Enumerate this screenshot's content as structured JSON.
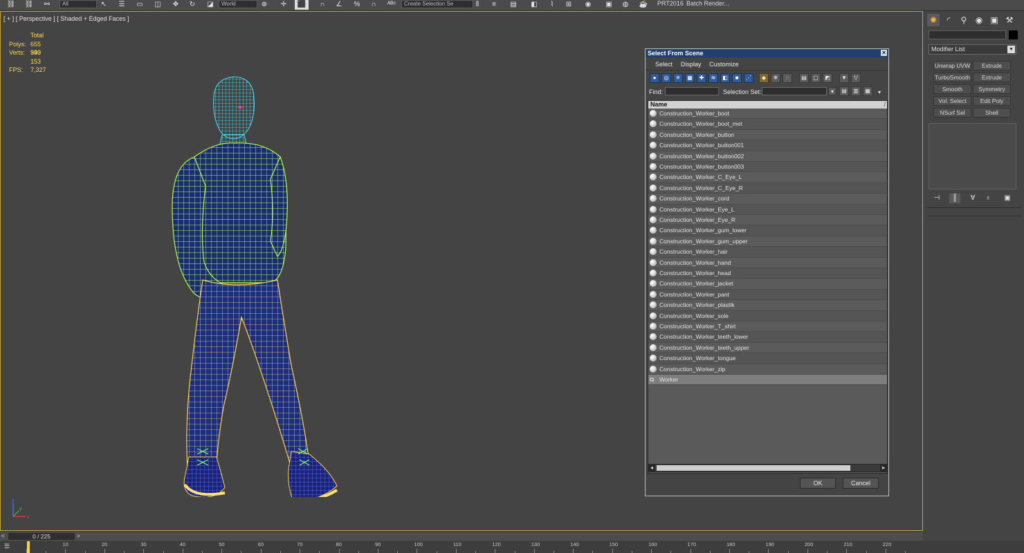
{
  "toolbar": {
    "selection_filter": "All",
    "reference_coord": "World",
    "named_selection_placeholder": "Create Selection Se",
    "prt_label": "PRT2016",
    "batch_render_label": "Batch Render..."
  },
  "viewport": {
    "label": "[ + ] [ Perspective ] [ Shaded + Edged Faces ]",
    "stats": {
      "total_label": "Total",
      "polys_label": "Polys:",
      "polys_value": "655 993",
      "verts_label": "Verts:",
      "verts_value": "340 153",
      "fps_label": "FPS:",
      "fps_value": "7,327"
    },
    "gizmo": {
      "x": "x",
      "y": "y",
      "z": "z"
    }
  },
  "dialog": {
    "title": "Select From Scene",
    "close_glyph": "×",
    "menu": [
      "Select",
      "Display",
      "Customize"
    ],
    "find_label": "Find:",
    "selection_set_label": "Selection Set:",
    "column_name": "Name",
    "items": [
      {
        "name": "Construction_Worker_boot",
        "type": "object"
      },
      {
        "name": "Construction_Worker_boot_met",
        "type": "object"
      },
      {
        "name": "Construction_Worker_button",
        "type": "object"
      },
      {
        "name": "Construction_Worker_button001",
        "type": "object"
      },
      {
        "name": "Construction_Worker_button002",
        "type": "object"
      },
      {
        "name": "Construction_Worker_button003",
        "type": "object"
      },
      {
        "name": "Construction_Worker_C_Eye_L",
        "type": "object"
      },
      {
        "name": "Construction_Worker_C_Eye_R",
        "type": "object"
      },
      {
        "name": "Construction_Worker_cord",
        "type": "object"
      },
      {
        "name": "Construction_Worker_Eye_L",
        "type": "object"
      },
      {
        "name": "Construction_Worker_Eye_R",
        "type": "object"
      },
      {
        "name": "Construction_Worker_gum_lower",
        "type": "object"
      },
      {
        "name": "Construction_Worker_gum_upper",
        "type": "object"
      },
      {
        "name": "Construction_Worker_hair",
        "type": "object"
      },
      {
        "name": "Construction_Worker_hand",
        "type": "object"
      },
      {
        "name": "Construction_Worker_head",
        "type": "object"
      },
      {
        "name": "Construction_Worker_jacket",
        "type": "object"
      },
      {
        "name": "Construction_Worker_pant",
        "type": "object"
      },
      {
        "name": "Construction_Worker_plastik",
        "type": "object"
      },
      {
        "name": "Construction_Worker_sole",
        "type": "object"
      },
      {
        "name": "Construction_Worker_T_shirt",
        "type": "object"
      },
      {
        "name": "Construction_Worker_teeth_lower",
        "type": "object"
      },
      {
        "name": "Construction_Worker_teeth_upper",
        "type": "object"
      },
      {
        "name": "Construction_Worker_tongue",
        "type": "object"
      },
      {
        "name": "Construction_Worker_zip",
        "type": "object"
      },
      {
        "name": "Worker",
        "type": "group",
        "selected": true
      }
    ],
    "ok_label": "OK",
    "cancel_label": "Cancel"
  },
  "command_panel": {
    "modifier_list_label": "Modifier List",
    "buttons": [
      [
        "Unwrap UVW",
        "Extrude"
      ],
      [
        "TurboSmooth",
        "Extrude"
      ],
      [
        "Smooth",
        "Symmetry"
      ],
      [
        "Vol. Select",
        "Edit Poly"
      ],
      [
        "NSurf Sel",
        "Shell"
      ]
    ]
  },
  "time_slider": {
    "frame_display": "0 / 225",
    "prev_glyph": "<",
    "next_glyph": ">"
  },
  "track_bar": {
    "labels": [
      "0",
      "10",
      "20",
      "30",
      "40",
      "50",
      "60",
      "70",
      "80",
      "90",
      "100",
      "110",
      "120",
      "130",
      "140",
      "150",
      "160",
      "170",
      "180",
      "190",
      "200",
      "210",
      "220"
    ]
  },
  "colors": {
    "viewport_border": "#c4a640",
    "stats_text": "#ffd94a",
    "dialog_title_bg": "#1f3f70",
    "wire_head": "#3fe3ff",
    "wire_jacket": "#b6ff3a",
    "wire_pants": "#ffd34a",
    "fill_pants": "#1d2f7a",
    "time_marker": "#ffd34a"
  }
}
